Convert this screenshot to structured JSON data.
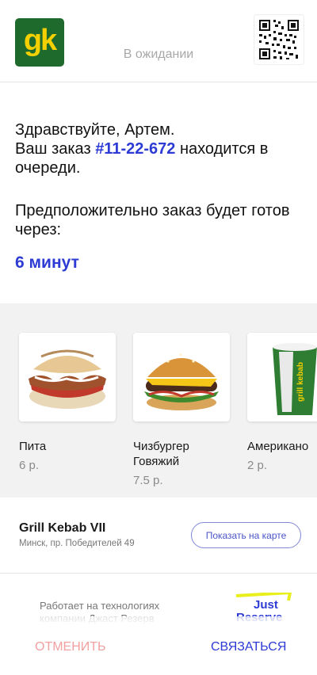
{
  "header": {
    "logo_text": "gk",
    "status": "В ожидании",
    "qr_icon": "qr-code-icon"
  },
  "order": {
    "greeting_line": "Здравствуйте, Артем.",
    "order_prefix": "Ваш заказ",
    "order_number": "#11-22-672",
    "order_suffix": "находится в очереди.",
    "eta_label": "Предположительно заказ будет готов через:",
    "eta_value": "6 минут"
  },
  "products": [
    {
      "name": "Пита",
      "price": "6 р.",
      "icon": "pita-image"
    },
    {
      "name": "Чизбургер Говяжий",
      "price": "7.5 р.",
      "icon": "cheeseburger-image"
    },
    {
      "name": "Американо",
      "price": "2 р.",
      "icon": "coffee-cup-image"
    }
  ],
  "store": {
    "name": "Grill Kebab VII",
    "address": "Минск, пр. Победителей 49",
    "map_button": "Показать на карте"
  },
  "powered_by": {
    "text": "Работает на технологиях компании Джаст Резерв",
    "logo_line1": "Just",
    "logo_line2": "Reserve"
  },
  "footer": {
    "cancel_label": "ОТМЕНИТЬ",
    "contact_label": "СВЯЗАТЬСЯ"
  },
  "colors": {
    "accent": "#2d3bd4",
    "brand_green": "#1e6a2c",
    "brand_yellow": "#f5d000",
    "cancel": "#f2a0a0"
  }
}
